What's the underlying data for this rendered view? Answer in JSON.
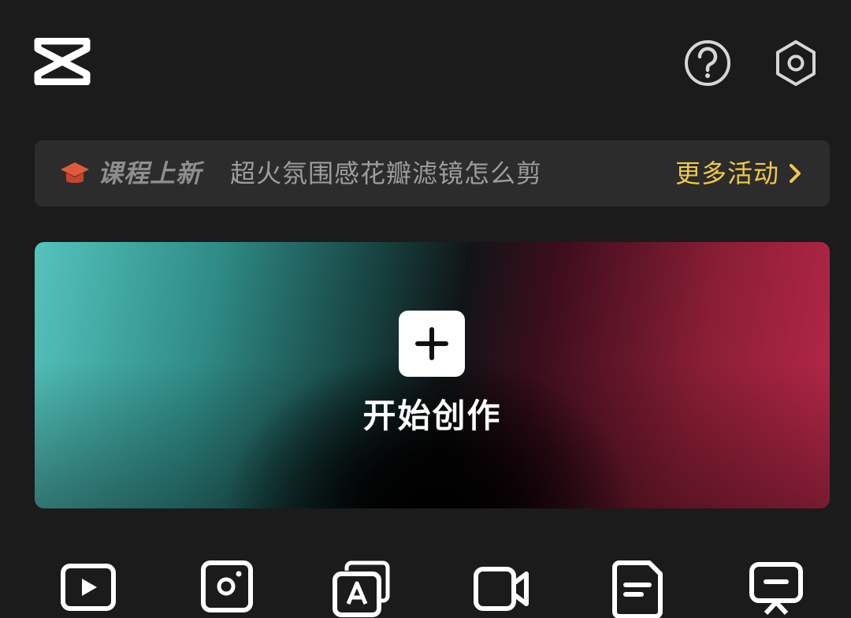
{
  "header": {
    "logo_icon": "capcut-logo-icon",
    "help_icon": "help-icon",
    "settings_icon": "settings-hexagon-icon"
  },
  "banner": {
    "tag": "课程上新",
    "message": "超火氛围感花瓣滤镜怎么剪",
    "more_link": "更多活动",
    "tag_icon": "graduation-cap-icon",
    "accent_color": "#f0c94a"
  },
  "hero": {
    "label": "开始创作",
    "action_icon": "plus-icon",
    "gradient_left": "#55c3bc",
    "gradient_right": "#b8274a"
  },
  "tools": [
    {
      "icon": "play-video-icon"
    },
    {
      "icon": "camera-frame-icon"
    },
    {
      "icon": "text-template-icon"
    },
    {
      "icon": "video-camera-icon"
    },
    {
      "icon": "document-icon"
    },
    {
      "icon": "presentation-icon"
    }
  ]
}
